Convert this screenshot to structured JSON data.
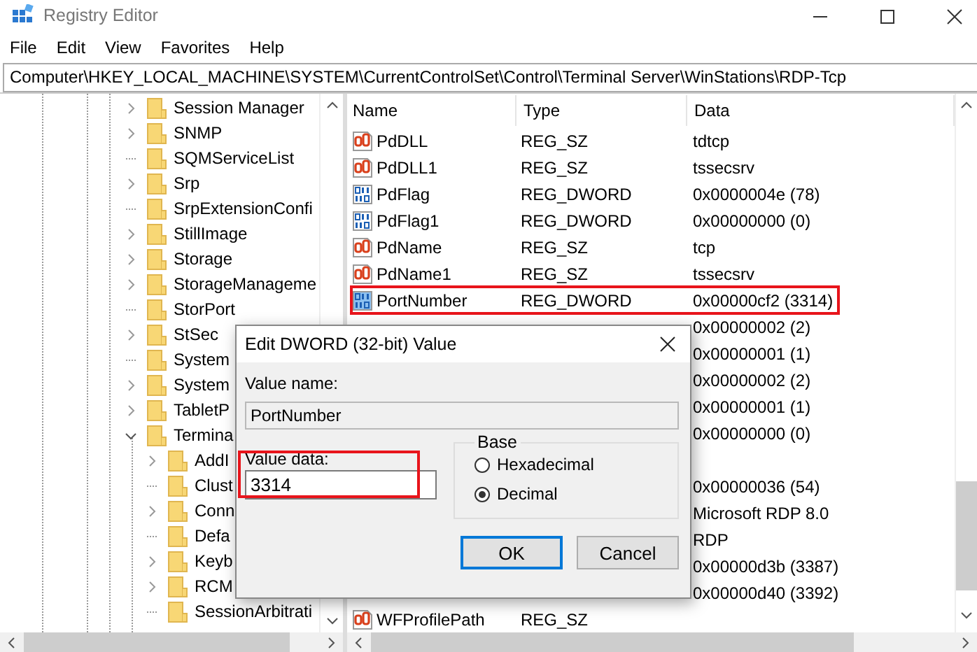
{
  "window": {
    "title": "Registry Editor"
  },
  "menu": [
    "File",
    "Edit",
    "View",
    "Favorites",
    "Help"
  ],
  "address": "Computer\\HKEY_LOCAL_MACHINE\\SYSTEM\\CurrentControlSet\\Control\\Terminal Server\\WinStations\\RDP-Tcp",
  "tree": {
    "items": [
      {
        "label": "Session Manager",
        "kind": "branch",
        "expanded": false
      },
      {
        "label": "SNMP",
        "kind": "branch",
        "expanded": false
      },
      {
        "label": "SQMServiceList",
        "kind": "leaf",
        "expanded": false
      },
      {
        "label": "Srp",
        "kind": "branch",
        "expanded": false
      },
      {
        "label": "SrpExtensionConfi",
        "kind": "leaf",
        "expanded": false
      },
      {
        "label": "StillImage",
        "kind": "branch",
        "expanded": false
      },
      {
        "label": "Storage",
        "kind": "branch",
        "expanded": false
      },
      {
        "label": "StorageManageme",
        "kind": "branch",
        "expanded": false
      },
      {
        "label": "StorPort",
        "kind": "leaf",
        "expanded": false
      },
      {
        "label": "StSec",
        "kind": "branch",
        "expanded": false
      },
      {
        "label": "System",
        "kind": "leaf",
        "expanded": false
      },
      {
        "label": "System",
        "kind": "branch",
        "expanded": false
      },
      {
        "label": "TabletP",
        "kind": "branch",
        "expanded": false
      },
      {
        "label": "Termina",
        "kind": "branch",
        "expanded": true,
        "children": [
          {
            "label": "AddI",
            "kind": "branch",
            "expanded": false
          },
          {
            "label": "Clust",
            "kind": "leaf",
            "expanded": false
          },
          {
            "label": "Conn",
            "kind": "branch",
            "expanded": false
          },
          {
            "label": "Defa",
            "kind": "leaf",
            "expanded": false
          },
          {
            "label": "Keyb",
            "kind": "branch",
            "expanded": false
          },
          {
            "label": "RCM",
            "kind": "branch",
            "expanded": false
          },
          {
            "label": "SessionArbitrati",
            "kind": "leaf",
            "expanded": false
          }
        ]
      }
    ]
  },
  "list": {
    "columns": [
      "Name",
      "Type",
      "Data"
    ],
    "rows": [
      {
        "kind": "string",
        "name": "PdDLL",
        "type": "REG_SZ",
        "data": "tdtcp",
        "highlighted": false
      },
      {
        "kind": "string",
        "name": "PdDLL1",
        "type": "REG_SZ",
        "data": "tssecsrv",
        "highlighted": false
      },
      {
        "kind": "dword",
        "name": "PdFlag",
        "type": "REG_DWORD",
        "data": "0x0000004e (78)",
        "highlighted": false
      },
      {
        "kind": "dword",
        "name": "PdFlag1",
        "type": "REG_DWORD",
        "data": "0x00000000 (0)",
        "highlighted": false
      },
      {
        "kind": "string",
        "name": "PdName",
        "type": "REG_SZ",
        "data": "tcp",
        "highlighted": false
      },
      {
        "kind": "string",
        "name": "PdName1",
        "type": "REG_SZ",
        "data": "tssecsrv",
        "highlighted": false
      },
      {
        "kind": "dword",
        "name": "PortNumber",
        "type": "REG_DWORD",
        "data": "0x00000cf2 (3314)",
        "highlighted": true
      },
      {
        "data": "0x00000002 (2)",
        "highlighted": false
      },
      {
        "data": "0x00000001 (1)",
        "highlighted": false
      },
      {
        "data": "0x00000002 (2)",
        "highlighted": false
      },
      {
        "data": "0x00000001 (1)",
        "highlighted": false
      },
      {
        "data": "0x00000000 (0)",
        "highlighted": false
      },
      {
        "highlighted": false
      },
      {
        "data": "0x00000036 (54)",
        "highlighted": false
      },
      {
        "data": "Microsoft RDP 8.0",
        "highlighted": false
      },
      {
        "data": "RDP",
        "highlighted": false
      },
      {
        "data": "0x00000d3b (3387)",
        "highlighted": false
      },
      {
        "data": "0x00000d40 (3392)",
        "highlighted": false
      },
      {
        "kind": "string",
        "name": "WFProfilePath",
        "type": "REG_SZ",
        "highlighted": false
      }
    ]
  },
  "dialog": {
    "title": "Edit DWORD (32-bit) Value",
    "value_name_label": "Value name:",
    "value_name": "PortNumber",
    "value_data_label": "Value data:",
    "value_data": "3314",
    "value_data_highlighted": true,
    "base_label": "Base",
    "base_options": [
      {
        "label": "Hexadecimal",
        "selected": false
      },
      {
        "label": "Decimal",
        "selected": true
      }
    ],
    "buttons": [
      {
        "label": "OK",
        "default": true
      },
      {
        "label": "Cancel",
        "default": false
      }
    ]
  }
}
